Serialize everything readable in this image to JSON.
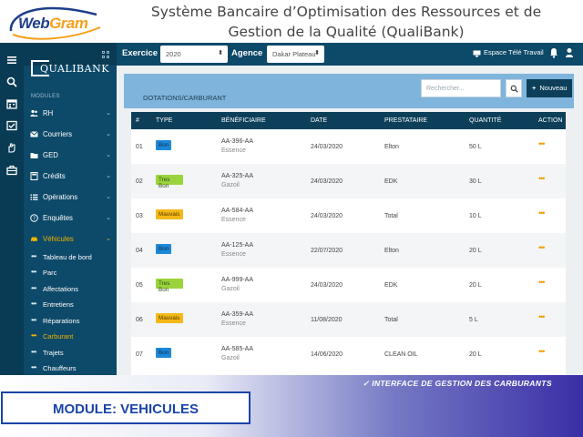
{
  "slide": {
    "logo": {
      "part1": "Web",
      "part2": "Gram"
    },
    "title_line1": "Système Bancaire d’Optimisation des Ressources et de",
    "title_line2": "Gestion de la Qualité (QualiBank)",
    "module_label": "MODULE: VEHICULES",
    "interface_note": "✓ INTERFACE DE GESTION DES CARBURANTS"
  },
  "header": {
    "exercice_label": "Exercice",
    "exercice_value": "2020",
    "agence_label": "Agence",
    "agence_value": "Dakar Plateau",
    "remote_label": "Espace Télé Travail"
  },
  "sidebar": {
    "brand": "QUALIBANK",
    "modules_label": "MODULES",
    "items": [
      {
        "label": "RH",
        "icon": "people-icon"
      },
      {
        "label": "Courriers",
        "icon": "mail-icon"
      },
      {
        "label": "GED",
        "icon": "folder-icon"
      },
      {
        "label": "Crédits",
        "icon": "calculator-icon"
      },
      {
        "label": "Opérations",
        "icon": "list-icon"
      },
      {
        "label": "Enquêtes",
        "icon": "help-icon"
      },
      {
        "label": "Véhicules",
        "icon": "car-icon"
      }
    ],
    "sub_items": [
      {
        "label": "Tableau de bord"
      },
      {
        "label": "Parc"
      },
      {
        "label": "Affectations"
      },
      {
        "label": "Entretiens"
      },
      {
        "label": "Réparations"
      },
      {
        "label": "Carburant"
      },
      {
        "label": "Trajets"
      },
      {
        "label": "Chauffeurs"
      }
    ]
  },
  "panel": {
    "title": "DOTATIONS/CARBURANT",
    "search_placeholder": "Rechercher...",
    "new_label": "Nouveau"
  },
  "table": {
    "columns": [
      "#",
      "TYPE",
      "BÉNÉFICIAIRE",
      "DATE",
      "PRESTATAIRE",
      "QUANTITÉ",
      "ACTION"
    ],
    "rows": [
      {
        "num": "01",
        "type": "Bon",
        "plate": "AA-396-AA",
        "fuel": "Essence",
        "date": "24/03/2020",
        "provider": "Elton",
        "qty": "50 L"
      },
      {
        "num": "02",
        "type": "Tres Bon",
        "plate": "AA-325-AA",
        "fuel": "Gazoil",
        "date": "24/03/2020",
        "provider": "EDK",
        "qty": "30 L"
      },
      {
        "num": "03",
        "type": "Mauvais",
        "plate": "AA-584-AA",
        "fuel": "Essence",
        "date": "24/03/2020",
        "provider": "Total",
        "qty": "10 L"
      },
      {
        "num": "04",
        "type": "Bon",
        "plate": "AA-125-AA",
        "fuel": "Essence",
        "date": "22/07/2020",
        "provider": "Elton",
        "qty": "20 L"
      },
      {
        "num": "05",
        "type": "Tres Bon",
        "plate": "AA-999-AA",
        "fuel": "Gazoil",
        "date": "24/03/2020",
        "provider": "EDK",
        "qty": "20 L"
      },
      {
        "num": "06",
        "type": "Mauvais",
        "plate": "AA-359-AA",
        "fuel": "Essence",
        "date": "11/08/2020",
        "provider": "Total",
        "qty": "5 L"
      },
      {
        "num": "07",
        "type": "Bon",
        "plate": "AA-585-AA",
        "fuel": "Gazoil",
        "date": "14/06/2020",
        "provider": "CLEAN OIL",
        "qty": "20 L"
      }
    ]
  },
  "colors": {
    "header_bg": "#0d4968",
    "badge_bon": "#1d88d8",
    "badge_tres_bon": "#9bd33c",
    "badge_mauvais": "#f4b818",
    "active_menu": "#f0b400"
  }
}
